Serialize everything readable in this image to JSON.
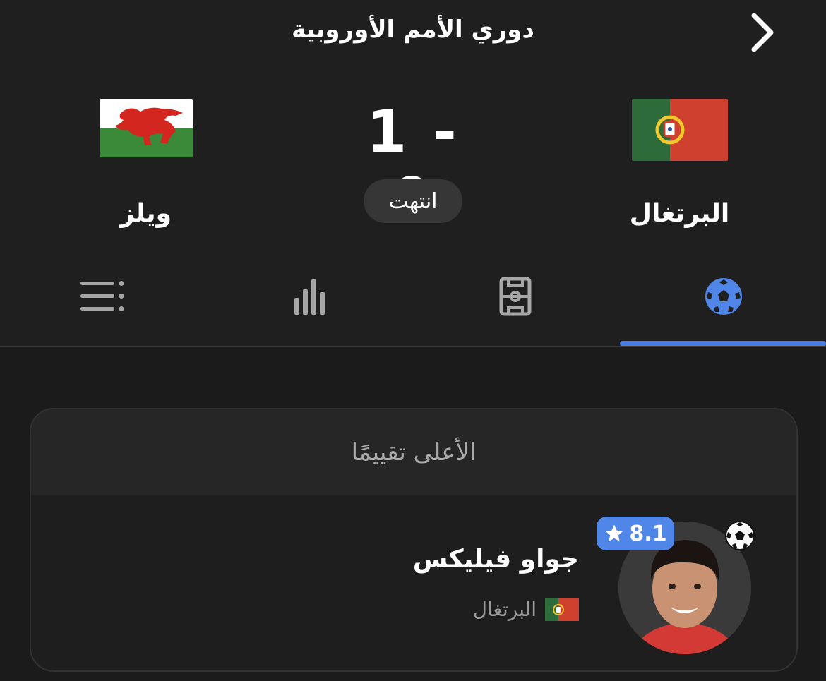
{
  "header": {
    "competition": "دوري الأمم الأوروبية",
    "home_team": "البرتغال",
    "away_team": "ويلز",
    "score": "1 - 0",
    "status": "انتهت"
  },
  "tabs": [
    {
      "icon": "football-icon",
      "active": true
    },
    {
      "icon": "pitch-lineup-icon",
      "active": false
    },
    {
      "icon": "stats-bars-icon",
      "active": false
    },
    {
      "icon": "list-icon",
      "active": false
    }
  ],
  "top_rated": {
    "title": "الأعلى تقييمًا",
    "player_name": "جواو فيليكس",
    "team": "البرتغال",
    "rating": "8.1"
  },
  "colors": {
    "accent": "#4a7be0",
    "rating_badge": "#4f86e8",
    "background": "#1f1f1f"
  }
}
